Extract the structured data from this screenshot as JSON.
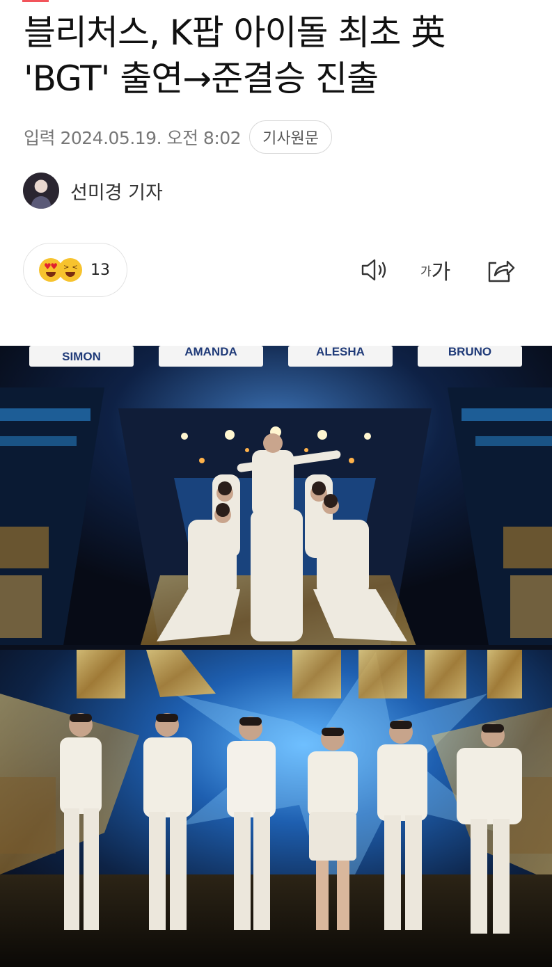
{
  "article": {
    "title": "블리처스, K팝 아이돌 최초 英 'BGT' 출연→준결승 진출",
    "published": "입력 2024.05.19. 오전 8:02",
    "source_button": "기사원문",
    "reporter": "선미경 기자"
  },
  "reactions": {
    "icons": [
      "heart-eyes-emoji",
      "laughing-emoji"
    ],
    "count": "13"
  },
  "toolbar": {
    "speaker_icon": "speaker-icon",
    "font_small": "가",
    "font_large": "가",
    "share_icon": "share-icon"
  },
  "photo": {
    "judge_names": [
      "SIMON",
      "AMANDA",
      "ALESHA",
      "BRUNO"
    ],
    "colors": {
      "stage_gold": "#c9a443",
      "stage_blue": "#1e73c8",
      "outfit": "#f1ede3"
    }
  }
}
